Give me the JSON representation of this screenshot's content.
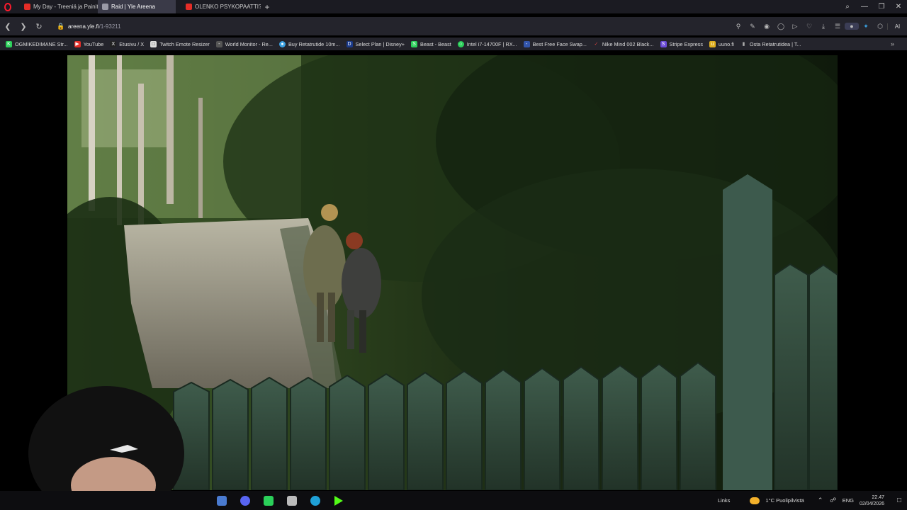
{
  "tabs": [
    {
      "title": "My Day - Treeniä ja Painit",
      "color": "#e52d27"
    },
    {
      "title": "Raid | Yle Areena",
      "color": "#9a9aa6"
    },
    {
      "title": "OLENKO PSYKOPAATTI? Fe",
      "color": "#e52d27"
    }
  ],
  "window_controls": {
    "search": "⌕",
    "minimize": "—",
    "restore": "❐",
    "close": "✕"
  },
  "address": {
    "url_domain": "areena.yle.fi",
    "url_path": "/1-93211"
  },
  "bookmarks": [
    {
      "label": "OGMIKEDIMANE Str...",
      "color": "#2bd05a"
    },
    {
      "label": "YouTube",
      "color": "#e52d27"
    },
    {
      "label": "Etusivu / X",
      "color": "#222222"
    },
    {
      "label": "Twitch Emote Resizer",
      "color": "#dddddd"
    },
    {
      "label": "World Monitor - Re...",
      "color": "#555555"
    },
    {
      "label": "Buy Retatrutide 10m...",
      "color": "#3aa0e0"
    },
    {
      "label": "Select Plan | Disney+",
      "color": "#1a3a8a"
    },
    {
      "label": "Beast - Beast",
      "color": "#2bd05a"
    },
    {
      "label": "Intel i7-14700F | RX...",
      "color": "#2bd05a"
    },
    {
      "label": "Best Free Face Swap...",
      "color": "#3355aa"
    },
    {
      "label": "Nike Mind 002 Black...",
      "color": "#d04040"
    },
    {
      "label": "Stripe Express",
      "color": "#6a4bd8"
    },
    {
      "label": "uuno.fi",
      "color": "#e0b020"
    },
    {
      "label": "Osta Retatrutidea | T...",
      "color": "#888888"
    }
  ],
  "bookmarks_more": "»",
  "taskbar": {
    "apps": [
      {
        "name": "app-1",
        "color": "#4a7bd0"
      },
      {
        "name": "discord",
        "color": "#5865f2"
      },
      {
        "name": "app-3",
        "color": "#2bd05a"
      },
      {
        "name": "app-4",
        "color": "#bbbbbb"
      },
      {
        "name": "edge",
        "color": "#1fa1d8"
      },
      {
        "name": "app-6",
        "color": "#53fc18"
      }
    ],
    "links": "Links",
    "weather": "1°C  Puolipilvistä",
    "lang": "ENG",
    "time": "22.47",
    "date": "02/04/2026"
  }
}
